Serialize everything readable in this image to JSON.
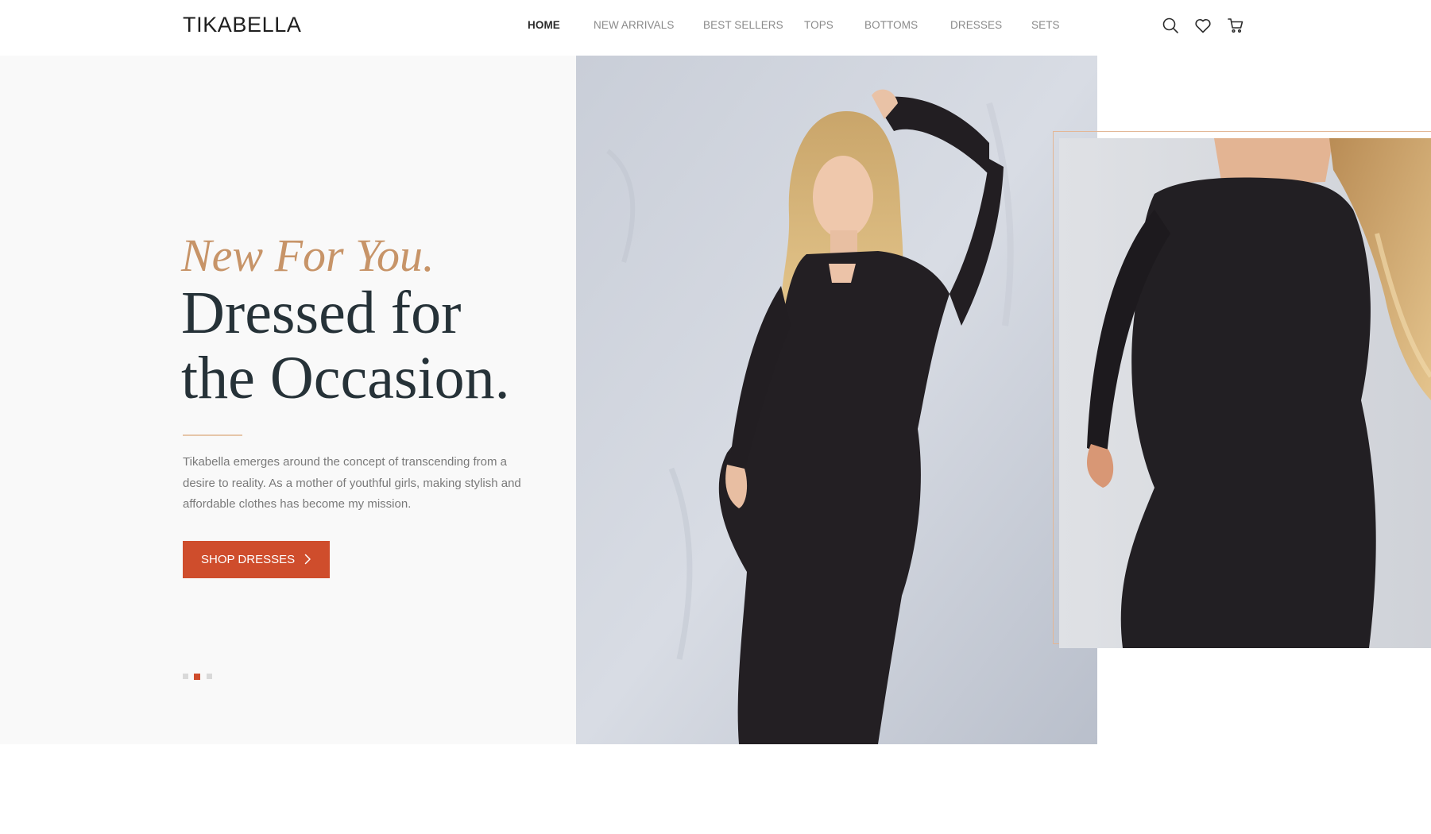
{
  "brand": {
    "logo": "TIKABELLA"
  },
  "nav": {
    "items": [
      {
        "label": "HOME",
        "active": true
      },
      {
        "label": "NEW ARRIVALS",
        "active": false
      },
      {
        "label": "BEST SELLERS",
        "active": false
      },
      {
        "label": "TOPS",
        "active": false
      },
      {
        "label": "BOTTOMS",
        "active": false
      },
      {
        "label": "DRESSES",
        "active": false
      },
      {
        "label": "SETS",
        "active": false
      }
    ]
  },
  "header_icons": [
    "search-icon",
    "heart-icon",
    "cart-icon"
  ],
  "hero": {
    "kicker": "New For You.",
    "headline_line1": "Dressed for",
    "headline_line2": "the Occasion.",
    "description": "Tikabella emerges around the concept of transcending from a desire to reality. As a mother of youthful girls, making stylish and affordable clothes has become my mission.",
    "cta_label": "SHOP DRESSES",
    "slides": {
      "count": 3,
      "active_index": 1
    }
  },
  "colors": {
    "accent": "#cf4d2c",
    "kicker": "#c79468",
    "headline": "#263238",
    "body_text": "#7a7a7a",
    "hero_bg": "#f9f9f9"
  }
}
